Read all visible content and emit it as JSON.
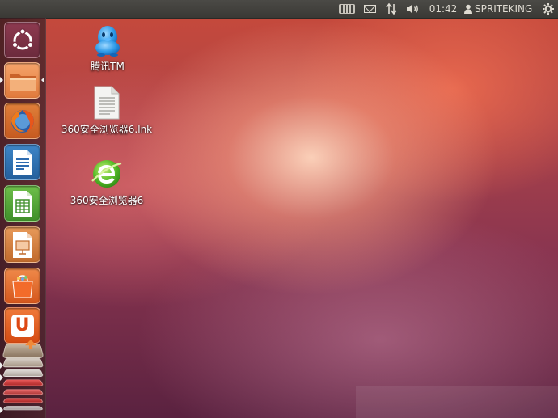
{
  "top_panel": {
    "indicators": {
      "keyboard": "keyboard-icon",
      "messaging": "envelope-icon",
      "network": "network-arrows-icon",
      "sound": "speaker-icon",
      "session": "gear-icon"
    },
    "clock": "01:42",
    "user_name": "SPRITEKING"
  },
  "launcher": {
    "items": [
      {
        "name": "dash-home",
        "icon": "ubuntu-logo-icon"
      },
      {
        "name": "files",
        "icon": "folder-icon"
      },
      {
        "name": "firefox",
        "icon": "firefox-icon"
      },
      {
        "name": "libreoffice-writer",
        "icon": "writer-icon"
      },
      {
        "name": "libreoffice-calc",
        "icon": "calc-icon"
      },
      {
        "name": "libreoffice-impress",
        "icon": "impress-icon"
      },
      {
        "name": "software-center",
        "icon": "shopping-bag-icon"
      },
      {
        "name": "ubuntu-one",
        "icon": "ubuntu-one-icon"
      },
      {
        "name": "stacked-apps",
        "icon": "stacked-launcher-icons"
      }
    ],
    "glyphs": {
      "ubuntu_one": "U"
    }
  },
  "desktop": {
    "icons": [
      {
        "label": "腾讯TM",
        "icon": "qq-penguin-icon"
      },
      {
        "label": "360安全浏览器6.lnk",
        "icon": "document-file-icon"
      },
      {
        "label": "360安全浏览器6",
        "icon": "360-browser-icon"
      }
    ]
  },
  "colors": {
    "panel": "#3c3b37",
    "launcher": "#4a2229",
    "accent": "#dd4814"
  }
}
